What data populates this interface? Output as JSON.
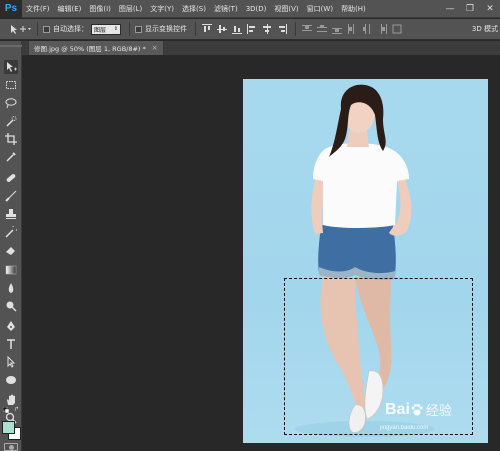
{
  "app": {
    "logo": "Ps"
  },
  "menu": {
    "items": [
      "文件(F)",
      "编辑(E)",
      "图像(I)",
      "图层(L)",
      "文字(Y)",
      "选择(S)",
      "滤镜(T)",
      "3D(D)",
      "视图(V)",
      "窗口(W)",
      "帮助(H)"
    ]
  },
  "window_controls": {
    "minimize": "—",
    "restore": "❐",
    "close": "✕"
  },
  "options": {
    "auto_select_label": "自动选择：",
    "auto_select_value": "图层",
    "show_transform_label": "显示变换控件",
    "mode_3d_label": "3D 模式"
  },
  "document": {
    "tab_title": "修图.jpg @ 50% (图层 1, RGB/8#) *",
    "tab_close": "×"
  },
  "colors": {
    "foreground": "#a8e0d2",
    "background": "#ffffff",
    "accent": "#31a8ff"
  },
  "watermark": {
    "brand": "Bai",
    "brand_suffix": "经验",
    "url": "jingyan.baidu.com"
  },
  "tools": [
    "move-tool",
    "marquee-tool",
    "lasso-tool",
    "quick-select-tool",
    "crop-tool",
    "eyedropper-tool",
    "healing-brush-tool",
    "brush-tool",
    "clone-stamp-tool",
    "history-brush-tool",
    "eraser-tool",
    "gradient-tool",
    "blur-tool",
    "dodge-tool",
    "pen-tool",
    "type-tool",
    "path-select-tool",
    "shape-tool",
    "hand-tool",
    "zoom-tool"
  ]
}
